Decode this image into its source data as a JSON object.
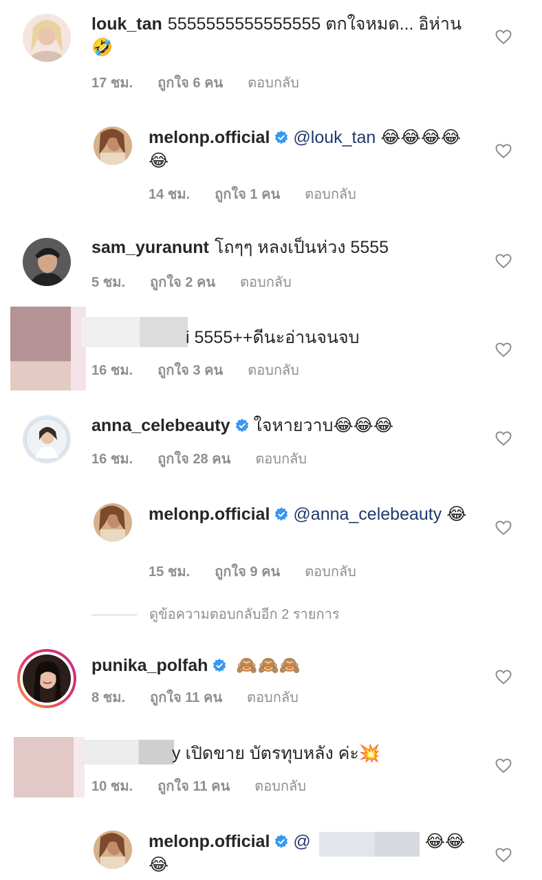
{
  "comments": [
    {
      "username": "louk_tan",
      "text": "5555555555555555 ตกใจหมด... อิห่าน",
      "emoji": "🤣",
      "time": "17 ชม.",
      "likes": "ถูกใจ 6 คน",
      "reply": "ตอบกลับ"
    },
    {
      "username": "melonp.official",
      "mention": "@louk_tan",
      "emoji": "😂😂😂😂😂",
      "time": "14 ชม.",
      "likes": "ถูกใจ 1 คน",
      "reply": "ตอบกลับ"
    },
    {
      "username": "sam_yuranunt",
      "text": "โถๆๆ หลงเป็นห่วง 5555",
      "time": "5 ชม.",
      "likes": "ถูกใจ 2 คน",
      "reply": "ตอบกลับ"
    },
    {
      "username": "",
      "text": "i 5555++ดีนะอ่านจนจบ",
      "time": "16 ชม.",
      "likes": "ถูกใจ 3 คน",
      "reply": "ตอบกลับ"
    },
    {
      "username": "anna_celebeauty",
      "text": "ใจหายวาบ",
      "emoji": "😂😂😂",
      "time": "16 ชม.",
      "likes": "ถูกใจ 28 คน",
      "reply": "ตอบกลับ"
    },
    {
      "username": "melonp.official",
      "mention": "@anna_celebeauty",
      "emoji": "😂",
      "time": "15 ชม.",
      "likes": "ถูกใจ 9 คน",
      "reply": "ตอบกลับ"
    },
    {
      "username": "punika_polfah",
      "emoji": "🙈🙈🙈",
      "time": "8 ชม.",
      "likes": "ถูกใจ 11 คน",
      "reply": "ตอบกลับ"
    },
    {
      "username": "",
      "text": "y เปิดขาย บัตรทุบหลัง ค่ะ",
      "emoji": "💥",
      "time": "10 ชม.",
      "likes": "ถูกใจ 11 คน",
      "reply": "ตอบกลับ"
    },
    {
      "username": "melonp.official",
      "mention": "@",
      "emoji": "😂😂😂"
    }
  ],
  "view_more_replies": "ดูข้อความตอบกลับอีก 2 รายการ",
  "icons": {
    "heart": "heart-icon",
    "verified": "verified-badge-icon"
  },
  "colors": {
    "verified": "#3897f0",
    "meta": "#8e8e8e",
    "mention": "#1e3a6d"
  }
}
